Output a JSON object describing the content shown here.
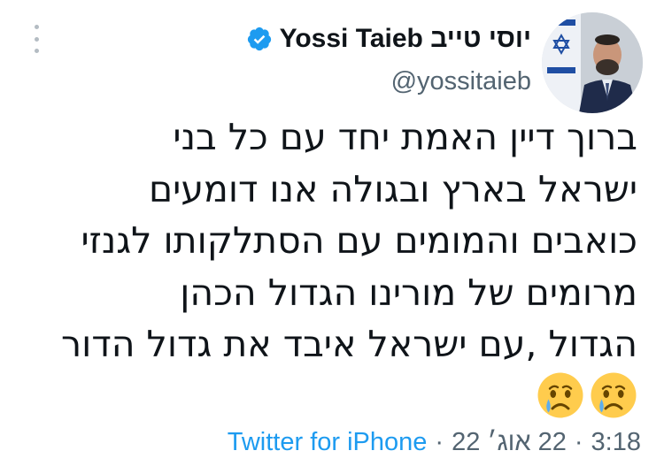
{
  "header": {
    "display_name": "Yossi Taieb יוסי טייב",
    "handle": "@yossitaieb",
    "verified_icon": "verified-badge-icon",
    "avatar_alt": "profile photo"
  },
  "tweet": {
    "lines": [
      "ברוך דיין האמת יחד עם כל בני",
      "ישראל בארץ ובגולה אנו דומעים",
      "כואבים והמומים עם הסתלקותו לגנזי",
      "מרומים של מורינו הגדול הכהן",
      "הגדול ,עם ישראל איבד את גדול הדור"
    ],
    "emojis": [
      "crying-face-icon",
      "crying-face-icon"
    ]
  },
  "meta": {
    "time": "3:18",
    "separator": "·",
    "date": "22 אוג׳ 22",
    "source": "Twitter for iPhone"
  },
  "menu": {
    "icon": "more-vertical-icon"
  },
  "colors": {
    "verified_blue": "#1d9bf0",
    "text": "#0f1419",
    "secondary": "#536471",
    "link": "#1d9bf0"
  }
}
